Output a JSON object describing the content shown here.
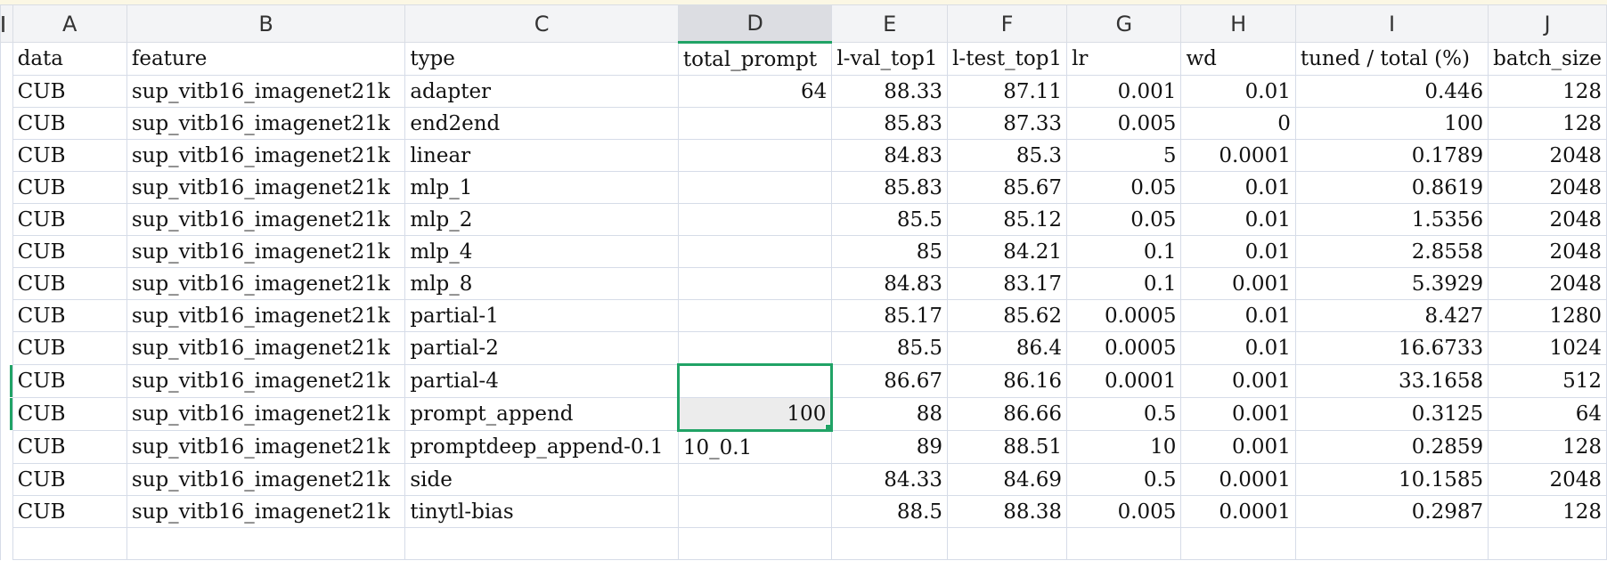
{
  "columns": [
    "A",
    "B",
    "C",
    "D",
    "E",
    "F",
    "G",
    "H",
    "I",
    "J"
  ],
  "active_column": "D",
  "header_row": [
    "data",
    "feature",
    "type",
    "total_prompt",
    "l-val_top1",
    "l-test_top1",
    "lr",
    "wd",
    "tuned / total (%)",
    "batch_size"
  ],
  "rows": [
    [
      "CUB",
      "sup_vitb16_imagenet21k",
      "adapter",
      "64",
      "88.33",
      "87.11",
      "0.001",
      "0.01",
      "0.446",
      "128"
    ],
    [
      "CUB",
      "sup_vitb16_imagenet21k",
      "end2end",
      "",
      "85.83",
      "87.33",
      "0.005",
      "0",
      "100",
      "128"
    ],
    [
      "CUB",
      "sup_vitb16_imagenet21k",
      "linear",
      "",
      "84.83",
      "85.3",
      "5",
      "0.0001",
      "0.1789",
      "2048"
    ],
    [
      "CUB",
      "sup_vitb16_imagenet21k",
      "mlp_1",
      "",
      "85.83",
      "85.67",
      "0.05",
      "0.01",
      "0.8619",
      "2048"
    ],
    [
      "CUB",
      "sup_vitb16_imagenet21k",
      "mlp_2",
      "",
      "85.5",
      "85.12",
      "0.05",
      "0.01",
      "1.5356",
      "2048"
    ],
    [
      "CUB",
      "sup_vitb16_imagenet21k",
      "mlp_4",
      "",
      "85",
      "84.21",
      "0.1",
      "0.01",
      "2.8558",
      "2048"
    ],
    [
      "CUB",
      "sup_vitb16_imagenet21k",
      "mlp_8",
      "",
      "84.83",
      "83.17",
      "0.1",
      "0.001",
      "5.3929",
      "2048"
    ],
    [
      "CUB",
      "sup_vitb16_imagenet21k",
      "partial-1",
      "",
      "85.17",
      "85.62",
      "0.0005",
      "0.01",
      "8.427",
      "1280"
    ],
    [
      "CUB",
      "sup_vitb16_imagenet21k",
      "partial-2",
      "",
      "85.5",
      "86.4",
      "0.0005",
      "0.01",
      "16.6733",
      "1024"
    ],
    [
      "CUB",
      "sup_vitb16_imagenet21k",
      "partial-4",
      "",
      "86.67",
      "86.16",
      "0.0001",
      "0.001",
      "33.1658",
      "512"
    ],
    [
      "CUB",
      "sup_vitb16_imagenet21k",
      "prompt_append",
      "100",
      "88",
      "86.66",
      "0.5",
      "0.001",
      "0.3125",
      "64"
    ],
    [
      "CUB",
      "sup_vitb16_imagenet21k",
      "promptdeep_append-0.1",
      "10_0.1",
      "89",
      "88.51",
      "10",
      "0.001",
      "0.2859",
      "128"
    ],
    [
      "CUB",
      "sup_vitb16_imagenet21k",
      "side",
      "",
      "84.33",
      "84.69",
      "0.5",
      "0.0001",
      "10.1585",
      "2048"
    ],
    [
      "CUB",
      "sup_vitb16_imagenet21k",
      "tinytl-bias",
      "",
      "88.5",
      "88.38",
      "0.005",
      "0.0001",
      "0.2987",
      "128"
    ],
    [
      "",
      "",
      "",
      "",
      "",
      "",
      "",
      "",
      "",
      ""
    ]
  ],
  "selection": {
    "column": "D",
    "rows": [
      11,
      12
    ]
  },
  "colors": {
    "selection_accent": "#21a366",
    "grid_line": "#d6dce8",
    "header_bg": "#f3f4f6",
    "active_header_bg": "#dcdde2",
    "selected_cell_bg": "#ececec"
  }
}
